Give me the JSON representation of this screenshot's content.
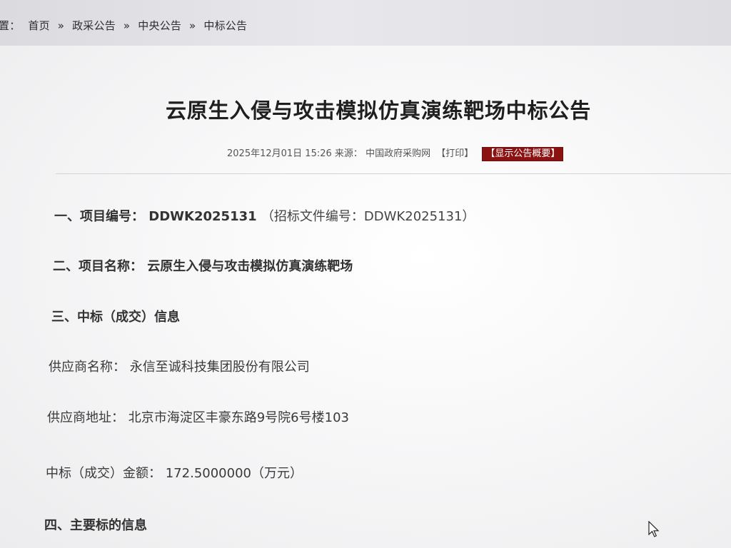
{
  "breadcrumb": {
    "label": "置：",
    "items": [
      {
        "label": "首页"
      },
      {
        "label": "政采公告"
      },
      {
        "label": "中央公告"
      },
      {
        "label": "中标公告"
      }
    ],
    "separator": "»"
  },
  "article": {
    "title": "云原生入侵与攻击模拟仿真演练靶场中标公告",
    "meta": {
      "datetime": "2025年12月01日 15:26",
      "source_label": "来源：",
      "source": "中国政府采购网",
      "print_link": "【打印】",
      "summary_button": "【显示公告概要】"
    },
    "sections": {
      "project_number_label": "一、项目编号：",
      "project_number": "DDWK2025131",
      "project_number_note": "（招标文件编号：DDWK2025131）",
      "project_name_label": "二、项目名称：",
      "project_name": "云原生入侵与攻击模拟仿真演练靶场",
      "award_info_heading": "三、中标（成交）信息",
      "main_target_heading": "四、主要标的信息"
    },
    "award_info": {
      "supplier_name_label": "供应商名称：",
      "supplier_name": "永信至诚科技集团股份有限公司",
      "supplier_address_label": "供应商地址：",
      "supplier_address": "北京市海淀区丰豪东路9号院6号楼103",
      "amount_label": "中标（成交）金额：",
      "amount": "172.5000000（万元）"
    }
  },
  "colors": {
    "summary_button_bg": "#8c1212",
    "title_text": "#1f1f1f",
    "body_text": "#3a3a3a"
  },
  "icons": {
    "cursor": "mouse-pointer-icon"
  }
}
